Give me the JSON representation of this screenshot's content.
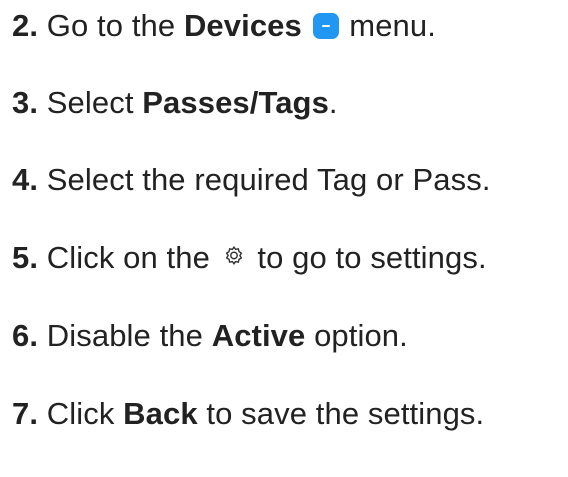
{
  "steps": [
    {
      "number": "2.",
      "parts": [
        "Go to the",
        "Devices",
        "menu."
      ],
      "icon": "devices-menu-icon"
    },
    {
      "number": "3.",
      "parts": [
        "Select",
        "Passes/Tags",
        "."
      ]
    },
    {
      "number": "4.",
      "parts": [
        "Select the required Tag or Pass."
      ]
    },
    {
      "number": "5.",
      "parts": [
        "Click on the",
        "to go to settings."
      ],
      "icon": "gear-icon"
    },
    {
      "number": "6.",
      "parts": [
        "Disable the",
        "Active",
        "option."
      ]
    },
    {
      "number": "7.",
      "parts": [
        "Click",
        "Back",
        "to save the settings."
      ]
    }
  ],
  "colors": {
    "text": "#222222",
    "devices_icon": "#2196f3"
  }
}
